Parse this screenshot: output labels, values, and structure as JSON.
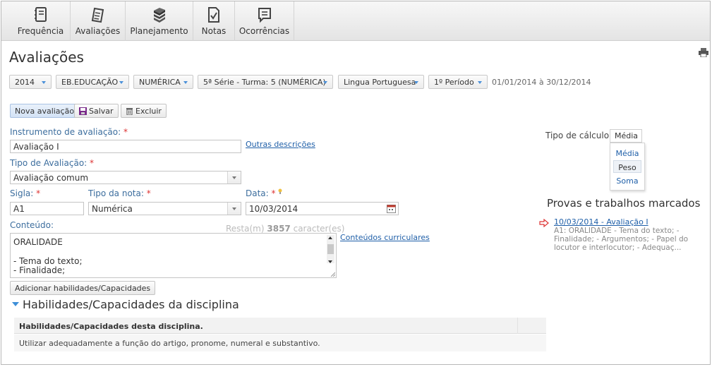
{
  "toolbar": {
    "items": [
      {
        "label": "Frequência",
        "icon": "notebook-icon"
      },
      {
        "label": "Avaliações",
        "icon": "notepad-icon"
      },
      {
        "label": "Planejamento",
        "icon": "books-icon"
      },
      {
        "label": "Notas",
        "icon": "check-document-icon"
      },
      {
        "label": "Ocorrências",
        "icon": "message-list-icon"
      }
    ]
  },
  "page": {
    "title": "Avaliações"
  },
  "filters": {
    "year": "2014",
    "course": "EB.EDUCAÇÃO",
    "grading": "NUMÉRICA",
    "class": "5ª Série - Turma: 5 (NUMÉRICA)",
    "subject": "Lingua Portuguesa",
    "term": "1º Período",
    "period_range": "01/01/2014 à 30/12/2014"
  },
  "actions": {
    "new": "Nova avaliação",
    "save": "Salvar",
    "delete": "Excluir"
  },
  "form": {
    "instrument_label": "Instrumento de avaliação:",
    "instrument_value": "Avaliação I",
    "other_descriptions": "Outras descrições",
    "type_label": "Tipo de Avaliação:",
    "type_value": "Avaliação comum",
    "sigla_label": "Sigla:",
    "sigla_value": "A1",
    "grade_type_label": "Tipo da nota:",
    "grade_type_value": "Numérica",
    "date_label": "Data:",
    "date_value": "10/03/2014",
    "content_label": "Conteúdo:",
    "remaining_prefix": "Resta(m)",
    "remaining_count": "3857",
    "remaining_suffix": "caracter(es)",
    "content_lines": [
      "ORALIDADE",
      "",
      "- Tema do texto;",
      "- Finalidade;"
    ],
    "curricular_link": "Conteúdos curriculares",
    "add_skills": "Adicionar habilidades/Capacidades",
    "required_mark": "*"
  },
  "skills": {
    "section_title": "Habilidades/Capacidades da disciplina",
    "header": "Habilidades/Capacidades desta disciplina.",
    "rows": [
      "Utilizar adequadamente a função do artigo, pronome, numeral e substantivo."
    ]
  },
  "calc": {
    "label": "Tipo de cálculo:",
    "selected": "Média",
    "options": [
      "Média",
      "Peso",
      "Soma"
    ],
    "highlighted": "Peso"
  },
  "scheduled": {
    "title": "Provas e trabalhos marcados",
    "items": [
      {
        "link": "10/03/2014 - Avaliação I",
        "desc": "A1: ORALIDADE - Tema do texto; - Finalidade; - Argumentos; - Papel do locutor e interlocutor; - Adequaç..."
      }
    ]
  },
  "colors": {
    "link": "#1f5fa8",
    "label": "#3d6e9e",
    "required": "#dd3333",
    "accent": "#3e8fd8"
  }
}
